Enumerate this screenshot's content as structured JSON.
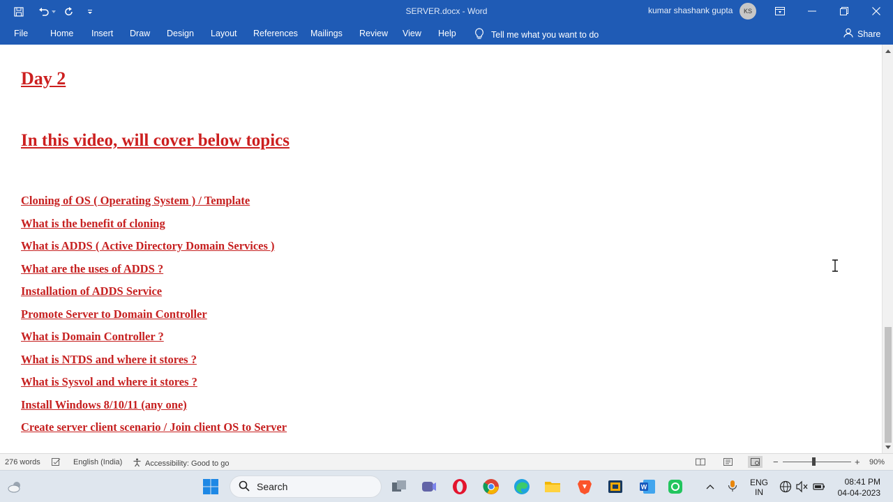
{
  "titlebar": {
    "title": "SERVER.docx  -  Word",
    "user_name": "kumar shashank gupta",
    "user_initials": "KS"
  },
  "ribbon": {
    "tabs": [
      "File",
      "Home",
      "Insert",
      "Draw",
      "Design",
      "Layout",
      "References",
      "Mailings",
      "Review",
      "View",
      "Help"
    ],
    "tell_me": "Tell me what you want to do",
    "share": "Share"
  },
  "document": {
    "heading_day": "Day 2",
    "heading_cover": "In this video, will cover below topics",
    "topics": [
      "Cloning of OS ( Operating System ) / Template",
      "What is the benefit of cloning",
      "What is ADDS ( Active Directory Domain Services )",
      "What are the uses of ADDS ?",
      "Installation of ADDS Service",
      "Promote Server to Domain Controller",
      "What is Domain Controller ?",
      "What is NTDS and where it stores ?",
      "What is Sysvol and where it stores ?",
      "Install Windows 8/10/11 (any one)",
      "Create server client scenario / Join client OS to Server"
    ]
  },
  "statusbar": {
    "word_count": "276 words",
    "language": "English (India)",
    "accessibility": "Accessibility: Good to go",
    "zoom_minus": "−",
    "zoom_plus": "+",
    "zoom_level": "90%"
  },
  "taskbar": {
    "search_label": "Search",
    "lang_line1": "ENG",
    "lang_line2": "IN",
    "time": "08:41 PM",
    "date": "04-04-2023"
  },
  "colors": {
    "ribbon_blue": "#1f5bb5",
    "heading_red": "#cc1f1f"
  }
}
